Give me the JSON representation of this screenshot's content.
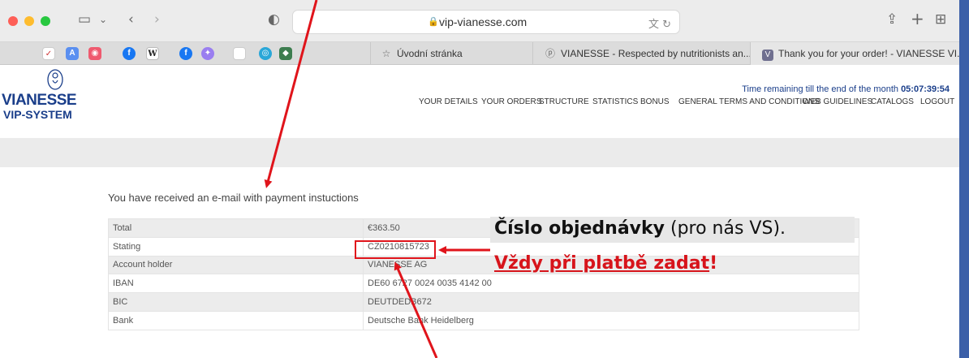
{
  "browser": {
    "url": "vip-vianesse.com",
    "tabs": [
      {
        "label": "Úvodní stránka",
        "icon": "star-icon"
      },
      {
        "label": "VIANESSE - Respected by nutritionists an...",
        "icon": "vianesse-favicon"
      },
      {
        "label": "Thank you for your order! - VIANESSE VI...",
        "icon": "v-favicon"
      }
    ],
    "favorites": [
      "checkmark",
      "translate",
      "pocket",
      "facebook",
      "wikipedia",
      "facebook",
      "messenger",
      "blank",
      "chrome",
      "app"
    ]
  },
  "site": {
    "logo_line1": "VIANESSE",
    "logo_line2": "VIP-SYSTEM",
    "timer_label": "Time remaining till the end of the month",
    "timer_value": "05:07:39:54",
    "nav": [
      "YOUR DETAILS",
      "YOUR ORDERS",
      "STRUCTURE",
      "STATISTICS",
      "BONUS",
      "GENERAL TERMS AND CONDITIONS",
      "WEB GUIDELINES",
      "CATALOGS",
      "LOGOUT"
    ]
  },
  "main": {
    "notice": "You have received an e-mail with payment instuctions",
    "rows": [
      {
        "label": "Total",
        "value": "€363.50"
      },
      {
        "label": "Stating",
        "value": "CZ0210815723"
      },
      {
        "label": "Account holder",
        "value": "VIANESSE AG"
      },
      {
        "label": "IBAN",
        "value": "DE60 6727 0024 0035 4142 00"
      },
      {
        "label": "BIC",
        "value": "DEUTDEDB672"
      },
      {
        "label": "Bank",
        "value": "Deutsche Bank Heidelberg"
      }
    ]
  },
  "annotation": {
    "line1_bold": "Číslo objednávky",
    "line1_rest": " (pro nás VS).",
    "line2_underlined": "Vždy při platbě zadat",
    "line2_tail": "!",
    "arrow_color": "#e0141b"
  }
}
